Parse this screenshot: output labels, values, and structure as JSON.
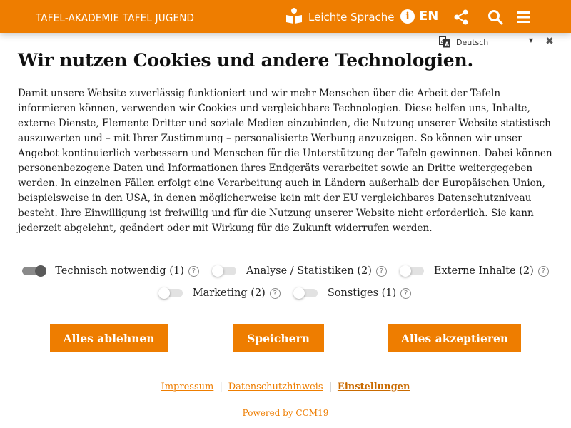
{
  "header": {
    "nav_akademie": "TAFEL-AKADEMIE",
    "nav_jugend": "TAFEL JUGEND",
    "leichte_sprache": "Leichte Sprache",
    "info_icon": "i",
    "lang_en": "EN",
    "icons": [
      "book-reader-icon",
      "info-icon",
      "share-icon",
      "search-icon",
      "hamburger-menu-icon"
    ],
    "background_color": "#ee7d00"
  },
  "banner": {
    "language_select": "Deutsch",
    "title": "Wir nutzen Cookies und andere Technologien.",
    "text": "Damit unsere Website zuverlässig funktioniert und wir mehr Menschen über die Arbeit der Tafeln informieren können, verwenden wir Cookies und vergleichbare Technologien. Diese helfen uns, Inhalte, externe Dienste, Elemente Dritter und soziale Medien einzubinden, die Nutzung unserer Website statistisch auszuwerten und – mit Ihrer Zustimmung – personalisierte Werbung anzuzeigen. So können wir unser Angebot kontinuierlich verbessern und Menschen für die Unterstützung der Tafeln gewinnen. Dabei können personenbezogene Daten und Informationen ihres Endgeräts verarbeitet sowie an Dritte weitergegeben werden. In einzelnen Fällen erfolgt eine Verarbeitung auch in Ländern außerhalb der Europäischen Union, beispielsweise in den USA, in denen möglicherweise kein mit der EU vergleichbares Datenschutzniveau besteht. Ihre Einwilligung ist freiwillig und für die Nutzung unserer Website nicht erforderlich. Sie kann jederzeit abgelehnt, geändert oder mit Wirkung für die Zukunft widerrufen werden.",
    "categories": [
      {
        "label": "Technisch notwendig (1)",
        "enabled": true,
        "help": "?"
      },
      {
        "label": "Analyse / Statistiken (2)",
        "enabled": false,
        "help": "?"
      },
      {
        "label": "Externe Inhalte (2)",
        "enabled": false,
        "help": "?"
      },
      {
        "label": "Marketing (2)",
        "enabled": false,
        "help": "?"
      },
      {
        "label": "Sonstiges (1)",
        "enabled": false,
        "help": "?"
      }
    ],
    "buttons": {
      "reject": "Alles ablehnen",
      "save": "Speichern",
      "accept": "Alles akzeptieren"
    },
    "links": {
      "impressum": "Impressum",
      "separator": "|",
      "datenschutz": "Datenschutzhinweis",
      "einstellungen": "Einstellungen"
    },
    "powered_by": "Powered by CCM19",
    "accent_color": "#ee7d00"
  }
}
